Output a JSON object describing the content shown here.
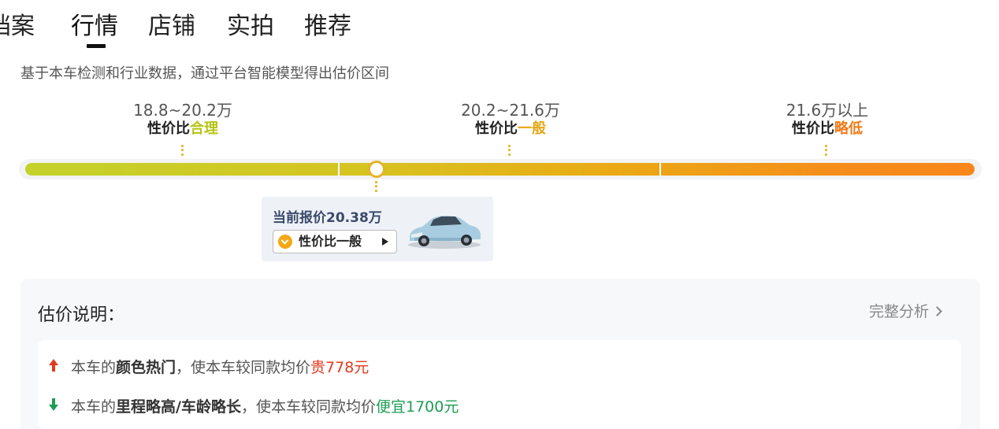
{
  "tabs": [
    {
      "label": "档案"
    },
    {
      "label": "行情"
    },
    {
      "label": "店铺"
    },
    {
      "label": "实拍"
    },
    {
      "label": "推荐"
    }
  ],
  "subtitle": "基于本车检测和行业数据，通过平台智能模型得出估价区间",
  "ranges": [
    {
      "price": "18.8~20.2万",
      "label_prefix": "性价比",
      "label_level": "合理",
      "level_color": "#b5c412"
    },
    {
      "price": "20.2~21.6万",
      "label_prefix": "性价比",
      "label_level": "一般",
      "level_color": "#e6a615"
    },
    {
      "price": "21.6万以上",
      "label_prefix": "性价比",
      "label_level": "略低",
      "level_color": "#f07b18"
    }
  ],
  "current": {
    "price_text": "当前报价20.38万",
    "tag_label": "性价比一般",
    "car_icon": "car-image"
  },
  "panel": {
    "title": "估价说明：",
    "full_analysis_label": "完整分析",
    "items": [
      {
        "direction": "up",
        "arrow_color": "#e23a1d",
        "prefix": "本车的",
        "bold": "颜色热门",
        "middle": "，使本车较同款均价",
        "highlight": "贵778元",
        "highlight_color": "#e23a1d"
      },
      {
        "direction": "down",
        "arrow_color": "#1f9d55",
        "prefix": "本车的",
        "bold": "里程略高/车龄略长",
        "middle": "，使本车较同款均价",
        "highlight": "便宜1700元",
        "highlight_color": "#1f9d55"
      }
    ]
  }
}
